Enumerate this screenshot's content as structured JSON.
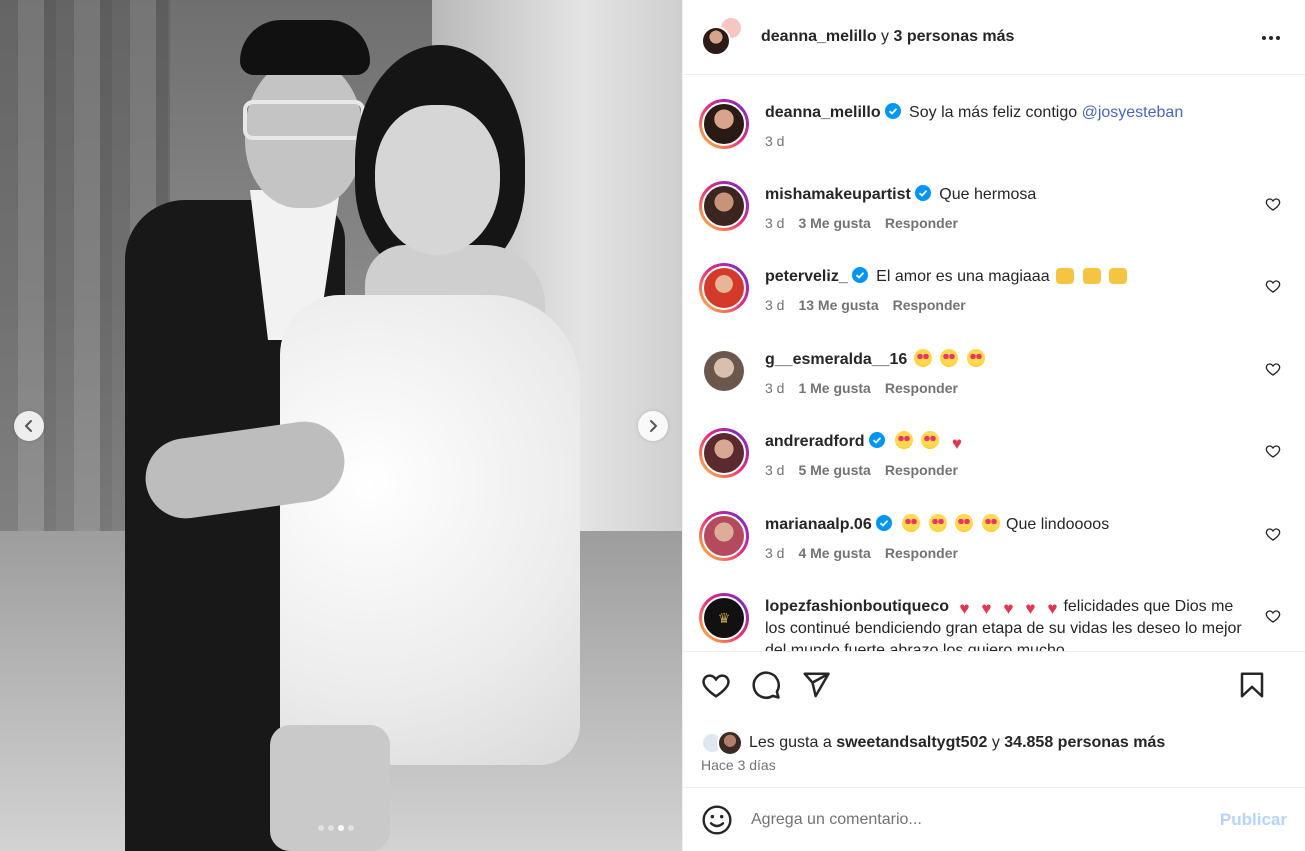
{
  "header": {
    "username": "deanna_melillo",
    "joiner": "y",
    "others": "3 personas más"
  },
  "caption": {
    "username": "deanna_melillo",
    "text": "Soy la más feliz contigo",
    "mention": "@josyesteban",
    "time": "3 d"
  },
  "comments": [
    {
      "username": "mishamakeupartist",
      "verified": true,
      "text": "Que hermosa",
      "time": "3 d",
      "likes": "3 Me gusta",
      "reply": "Responder",
      "avatar_color": "#6b4a40"
    },
    {
      "username": "peterveliz_",
      "verified": true,
      "text": "El amor es una magiaaa",
      "time": "3 d",
      "likes": "13 Me gusta",
      "reply": "Responder",
      "avatar_color": "#d43a2a"
    },
    {
      "username": "g__esmeralda__16",
      "verified": false,
      "text": "",
      "time": "3 d",
      "likes": "1 Me gusta",
      "reply": "Responder",
      "avatar_color": "#a58d7e"
    },
    {
      "username": "andreradford",
      "verified": true,
      "text": "",
      "time": "3 d",
      "likes": "5 Me gusta",
      "reply": "Responder",
      "avatar_color": "#7a3a3f"
    },
    {
      "username": "marianaalp.06",
      "verified": true,
      "text": "Que lindoooos",
      "time": "3 d",
      "likes": "4 Me gusta",
      "reply": "Responder",
      "avatar_color": "#b5495e"
    },
    {
      "username": "lopezfashionboutiqueco",
      "verified": false,
      "text": "felicidades que Dios me los continué bendiciendo gran etapa de su vidas les deseo lo mejor del mundo fuerte abrazo los quiero mucho",
      "avatar_color": "#111111"
    }
  ],
  "likes": {
    "prefix": "Les gusta a",
    "user": "sweetandsaltygt502",
    "joiner": "y",
    "count": "34.858 personas más"
  },
  "timeago": "Hace 3 días",
  "composer": {
    "placeholder": "Agrega un comentario...",
    "publish": "Publicar"
  },
  "carousel": {
    "total": 4,
    "active_index": 2
  },
  "colors": {
    "accent": "#0095f6",
    "mention": "#4468bf",
    "publish_disabled": "#b3d4fc",
    "verified": "#0095f6"
  },
  "icons": [
    "chevron-left-icon",
    "chevron-right-icon",
    "more-icon",
    "heart-icon",
    "comment-icon",
    "share-icon",
    "bookmark-icon",
    "emoji-icon",
    "verified-icon"
  ]
}
